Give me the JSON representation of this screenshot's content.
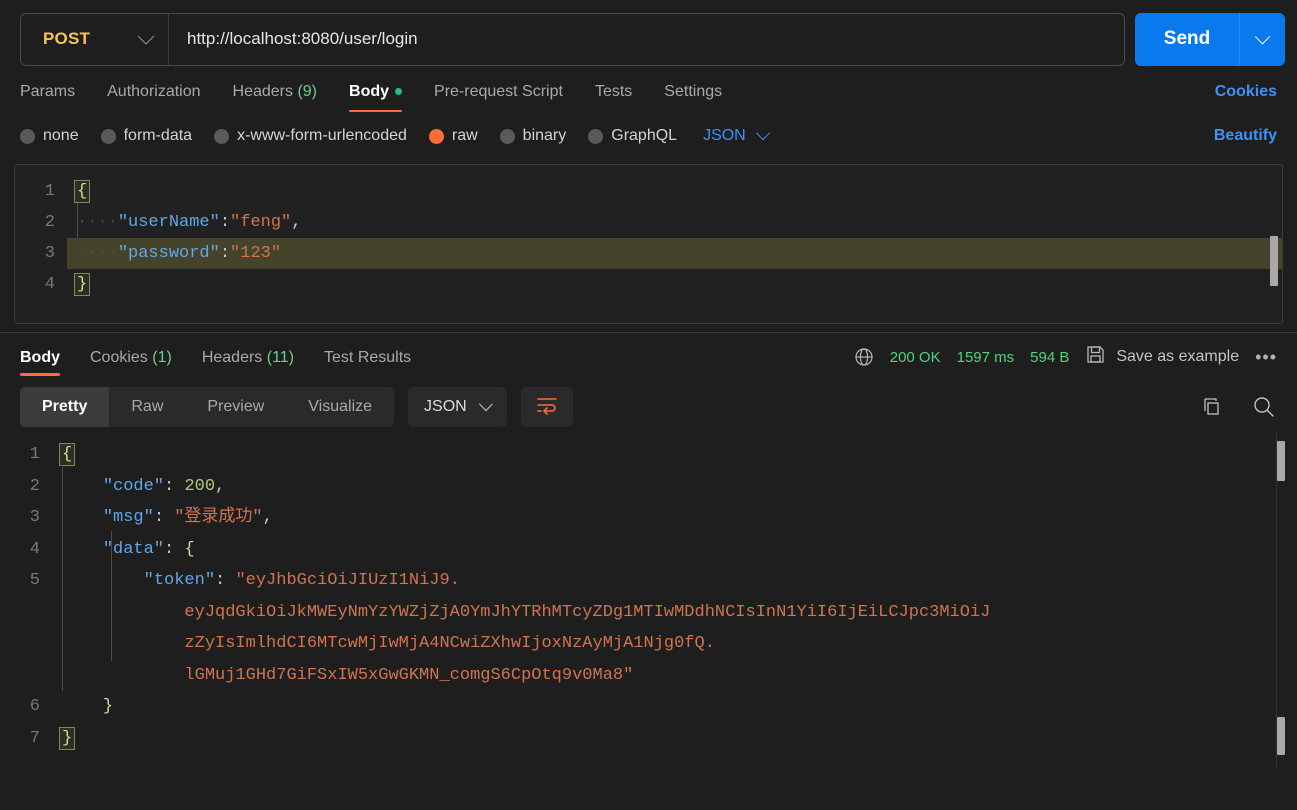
{
  "request": {
    "method": "POST",
    "url": "http://localhost:8080/user/login",
    "send_label": "Send",
    "tabs": [
      {
        "label": "Params",
        "active": false
      },
      {
        "label": "Authorization",
        "active": false
      },
      {
        "label": "Headers",
        "count": "(9)",
        "active": false
      },
      {
        "label": "Body",
        "active": true,
        "dot": true
      },
      {
        "label": "Pre-request Script",
        "active": false
      },
      {
        "label": "Tests",
        "active": false
      },
      {
        "label": "Settings",
        "active": false
      }
    ],
    "cookies_link": "Cookies",
    "body_types": [
      {
        "label": "none",
        "selected": false
      },
      {
        "label": "form-data",
        "selected": false
      },
      {
        "label": "x-www-form-urlencoded",
        "selected": false
      },
      {
        "label": "raw",
        "selected": true
      },
      {
        "label": "binary",
        "selected": false
      },
      {
        "label": "GraphQL",
        "selected": false
      }
    ],
    "format": "JSON",
    "beautify_label": "Beautify",
    "body_lines": [
      "1",
      "2",
      "3",
      "4"
    ],
    "body_code": {
      "l1_brace": "{",
      "l2_dots": "····",
      "l2_key": "\"userName\"",
      "l2_colon": ":",
      "l2_val": "\"feng\"",
      "l2_comma": ",",
      "l3_dots": "····",
      "l3_key": "\"password\"",
      "l3_colon": ":",
      "l3_val": "\"123\"",
      "l4_brace": "}"
    }
  },
  "response": {
    "tabs": [
      {
        "label": "Body",
        "active": true
      },
      {
        "label": "Cookies",
        "count": "(1)",
        "active": false
      },
      {
        "label": "Headers",
        "count": "(11)",
        "active": false
      },
      {
        "label": "Test Results",
        "active": false
      }
    ],
    "status": "200 OK",
    "time": "1597 ms",
    "size": "594 B",
    "save_example_label": "Save as example",
    "more_label": "•••",
    "view_modes": [
      {
        "label": "Pretty",
        "active": true
      },
      {
        "label": "Raw",
        "active": false
      },
      {
        "label": "Preview",
        "active": false
      },
      {
        "label": "Visualize",
        "active": false
      }
    ],
    "format": "JSON",
    "line_numbers": [
      "1",
      "2",
      "3",
      "4",
      "5",
      "",
      "",
      "",
      "6",
      "7"
    ],
    "body_code": {
      "l1_brace": "{",
      "l2_indent": "    ",
      "l2_key": "\"code\"",
      "l2_sep": ": ",
      "l2_val": "200",
      "l2_comma": ",",
      "l3_indent": "    ",
      "l3_key": "\"msg\"",
      "l3_sep": ": ",
      "l3_val": "\"登录成功\"",
      "l3_comma": ",",
      "l4_indent": "    ",
      "l4_key": "\"data\"",
      "l4_sep": ": ",
      "l4_brace": "{",
      "l5_indent": "        ",
      "l5_key": "\"token\"",
      "l5_sep": ": ",
      "l5_val_1": "\"eyJhbGciOiJIUzI1NiJ9.",
      "l5_wrap_indent": "            ",
      "l5_val_2": "eyJqdGkiOiJkMWEyNmYzYWZjZjA0YmJhYTRhMTcyZDg1MTIwMDdhNCIsInN1YiI6IjEiLCJpc3MiOiJ",
      "l5_val_3": "zZyIsImlhdCI6MTcwMjIwMjA4NCwiZXhwIjoxNzAyMjA1Njg0fQ.",
      "l5_val_4": "lGMuj1GHd7GiFSxIW5xGwGKMN_comgS6CpOtq9v0Ma8\"",
      "l6_indent": "    ",
      "l6_brace": "}",
      "l7_brace": "}"
    }
  },
  "icons": {
    "chevron_down": "chevron-down-icon",
    "globe": "globe-icon",
    "save": "save-icon",
    "wrap": "word-wrap-icon",
    "copy": "copy-icon",
    "search": "search-icon"
  },
  "colors": {
    "accent_orange": "#ff6c37",
    "link_blue": "#3b93f7",
    "send_blue": "#0b79ee",
    "status_green": "#4ed47f",
    "method_yellow": "#f5c451",
    "json_key": "#62a6e8",
    "json_string": "#d2734f",
    "json_number": "#b3c97a"
  }
}
